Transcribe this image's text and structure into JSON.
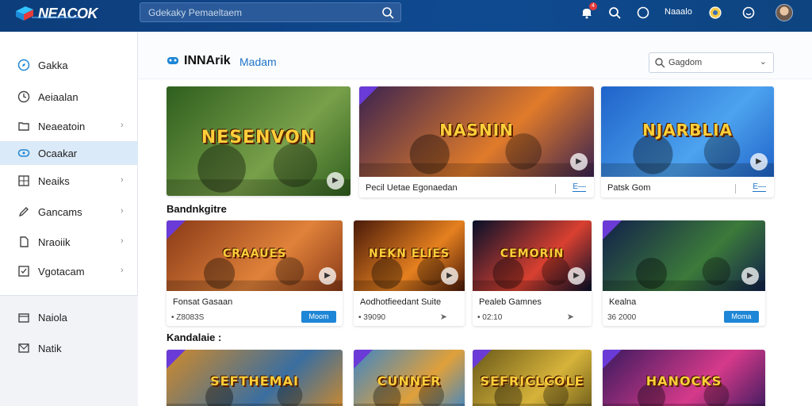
{
  "header": {
    "logo_text": "NEACOK",
    "search_placeholder": "Gdekaky Pemaeltaem",
    "nav_text": "Naaalo",
    "notification_count": "4"
  },
  "sidebar": {
    "items": [
      {
        "label": "Gakka",
        "icon": "compass-icon",
        "chevron": false
      },
      {
        "label": "Aeiaalan",
        "icon": "clock-icon",
        "chevron": false
      },
      {
        "label": "Neaeatoin",
        "icon": "folder-icon",
        "chevron": true
      },
      {
        "label": "Ocaakar",
        "icon": "gamepad-icon",
        "chevron": false,
        "active": true
      },
      {
        "label": "Neaiks",
        "icon": "grid-icon",
        "chevron": true
      },
      {
        "label": "Gancams",
        "icon": "pen-icon",
        "chevron": true
      },
      {
        "label": "Nraoiik",
        "icon": "document-icon",
        "chevron": true
      },
      {
        "label": "Vgotacam",
        "icon": "check-box-icon",
        "chevron": true
      }
    ],
    "footer_items": [
      {
        "label": "Naiola",
        "icon": "box-icon"
      },
      {
        "label": "Natik",
        "icon": "mail-icon"
      }
    ]
  },
  "main": {
    "title": "INNArik",
    "title_sub": "Madam",
    "sort_label": "Gagdom",
    "featured": [
      {
        "thumb_text": "NESENVON",
        "label": "",
        "link": "",
        "colors": [
          "#2f5f1e",
          "#78a04a"
        ]
      },
      {
        "thumb_text": "NASNIN",
        "label": "Pecil Uetae Egonaedan",
        "link": "E—",
        "colors": [
          "#3b2350",
          "#e07b2a"
        ]
      },
      {
        "thumb_text": "NJARBLIA",
        "label": "Patsk Gom",
        "link": "E—",
        "colors": [
          "#1f63c9",
          "#4da3ef"
        ]
      }
    ],
    "section1": "Bandnkgitre",
    "row1": [
      {
        "thumb_text": "CRAAUES",
        "label": "Fonsat Gasaan",
        "meta": "• Z8083S",
        "button": "Moom",
        "colors": [
          "#8a3a18",
          "#e0823a"
        ]
      },
      {
        "thumb_text": "NEKN ELIES",
        "label": "Aodhotfieedant Suite",
        "meta": "• 39090",
        "button": "",
        "colors": [
          "#4a1a0a",
          "#e5801f"
        ]
      },
      {
        "thumb_text": "CEMORIN",
        "label": "Pealeb Gamnes",
        "meta": "• 02:10",
        "button": "",
        "colors": [
          "#06102a",
          "#d94030"
        ]
      },
      {
        "thumb_text": "",
        "label": "Kealna",
        "meta": "36 2000",
        "button": "Moma",
        "colors": [
          "#12204a",
          "#3c7a3a"
        ]
      }
    ],
    "section2": "Kandalaie :",
    "row2": [
      {
        "thumb_text": "SEFTHEMAI",
        "colors": [
          "#d08a2a",
          "#3a6ea0"
        ]
      },
      {
        "thumb_text": "CUNNER",
        "colors": [
          "#3e86c6",
          "#e0a03a"
        ]
      },
      {
        "thumb_text": "SEFRICLCOLE",
        "colors": [
          "#6a5a1a",
          "#d6b33a"
        ]
      },
      {
        "thumb_text": "HANOCKS",
        "colors": [
          "#3a1a5e",
          "#d63a8a"
        ]
      }
    ]
  }
}
